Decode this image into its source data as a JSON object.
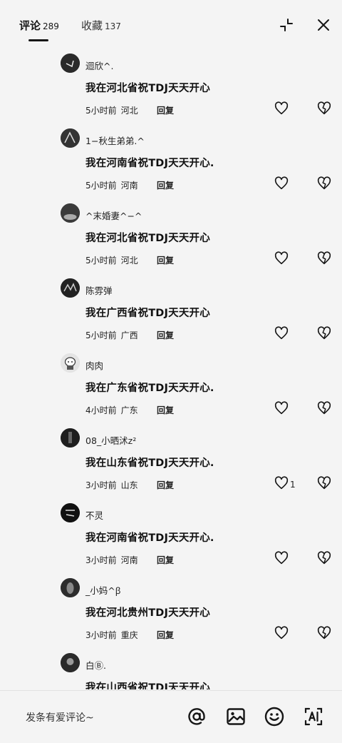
{
  "header": {
    "tab_comments": "评论",
    "comments_count": "289",
    "tab_favorites": "收藏",
    "favorites_count": "137"
  },
  "comments": [
    {
      "user": "迴欣^.",
      "text": "我在河北省祝TDJ天天开心",
      "time": "5小时前",
      "location": "河北",
      "reply": "回复",
      "likes": ""
    },
    {
      "user": "1−秋生弟弟.^",
      "text": "我在河南省祝TDJ天天开心.",
      "time": "5小时前",
      "location": "河南",
      "reply": "回复",
      "likes": ""
    },
    {
      "user": "^末婚妻^−^",
      "text": "我在河北省祝TDJ天天开心",
      "time": "5小时前",
      "location": "河北",
      "reply": "回复",
      "likes": ""
    },
    {
      "user": "陈雰弹",
      "text": "我在广西省祝TDJ天天开心",
      "time": "5小时前",
      "location": "广西",
      "reply": "回复",
      "likes": ""
    },
    {
      "user": "肉肉",
      "text": "我在广东省祝TDJ天天开心.",
      "time": "4小时前",
      "location": "广东",
      "reply": "回复",
      "likes": ""
    },
    {
      "user": "08_小晒沭z²",
      "text": "我在山东省祝TDJ天天开心.",
      "time": "3小时前",
      "location": "山东",
      "reply": "回复",
      "likes": "1"
    },
    {
      "user": "不灵",
      "text": "我在河南省祝TDJ天天开心.",
      "time": "3小时前",
      "location": "河南",
      "reply": "回复",
      "likes": ""
    },
    {
      "user": "_小妈^ꞵ",
      "text": "我在河北贵州TDJ天天开心",
      "time": "3小时前",
      "location": "重庆",
      "reply": "回复",
      "likes": ""
    },
    {
      "user": "白Ⓑ.",
      "text": "我在山西省祝TDJ天天开心",
      "time": "",
      "location": "",
      "reply": "",
      "likes": ""
    }
  ],
  "bottom": {
    "input_placeholder": "发条有爱评论~"
  },
  "icons": {
    "collapse": "collapse-icon",
    "close": "close-icon",
    "like": "heart-icon",
    "dislike": "broken-heart-icon",
    "at": "at-icon",
    "image": "image-icon",
    "emoji": "emoji-icon",
    "ai": "ai-icon"
  }
}
